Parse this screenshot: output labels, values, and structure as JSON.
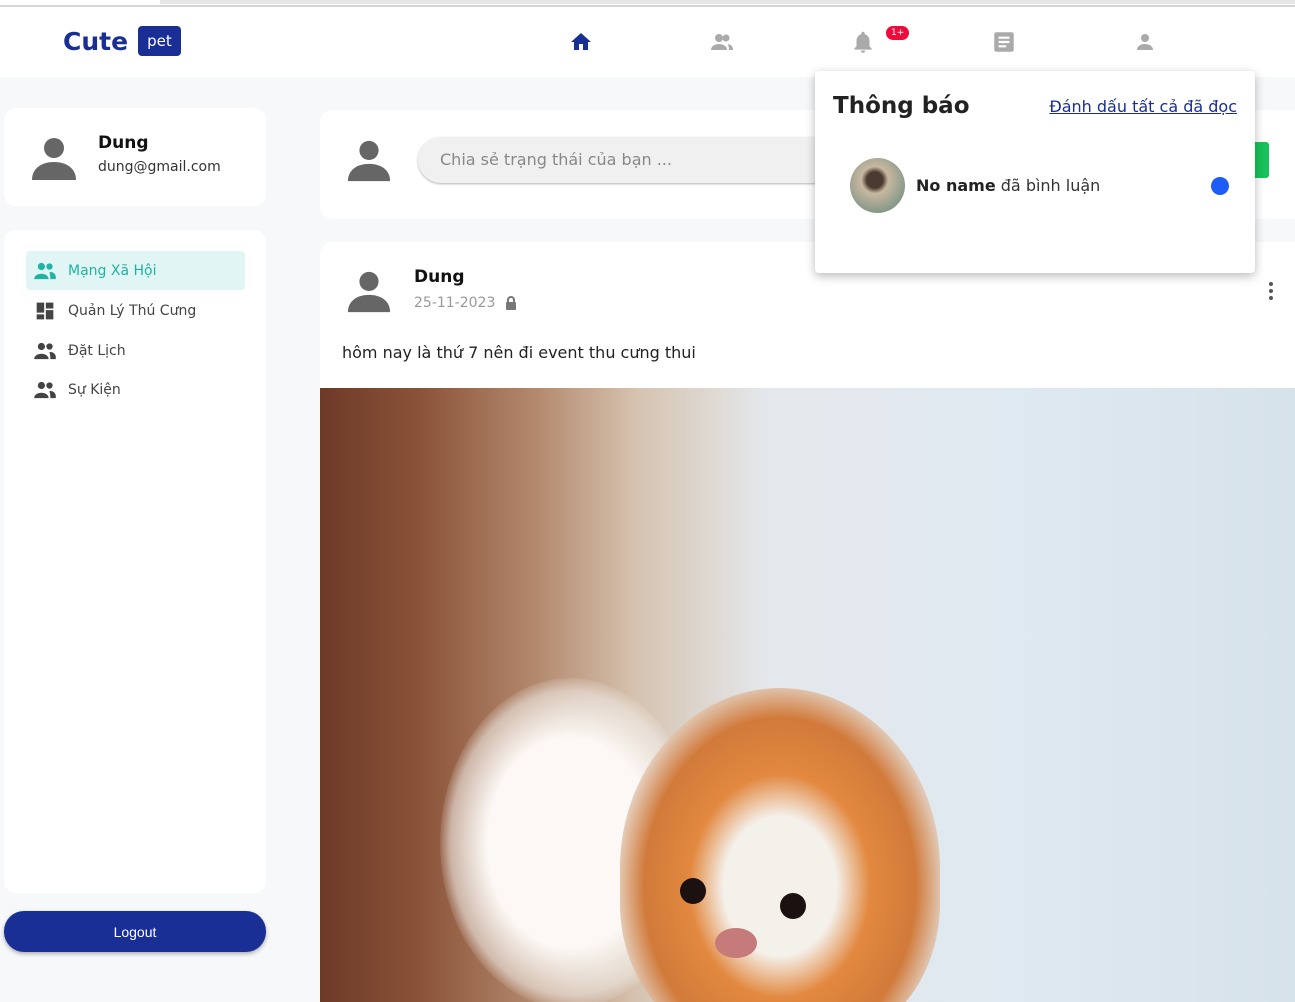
{
  "header": {
    "logo_text": "Cute",
    "logo_badge": "pet",
    "nav": [
      "home-icon",
      "friends-icon",
      "bell-icon",
      "news-icon",
      "user-icon"
    ],
    "notification_badge": "1+",
    "accent": "#1a2f96"
  },
  "profile": {
    "name": "Dung",
    "email": "dung@gmail.com"
  },
  "sidebar": {
    "items": [
      {
        "label": "Mạng Xã Hội",
        "active": true
      },
      {
        "label": "Quản Lý Thú Cưng"
      },
      {
        "label": "Đặt Lịch"
      },
      {
        "label": "Sự Kiện"
      }
    ],
    "logout": "Logout"
  },
  "status": {
    "placeholder": "Chia sẻ trạng thái của bạn ..."
  },
  "post": {
    "author": "Dung",
    "date": "25-11-2023",
    "text": "hôm nay là thứ 7 nên đi event thu cưng thui"
  },
  "notifications": {
    "title": "Thông báo",
    "mark_all": "Đánh dấu tất cả đã đọc",
    "items": [
      {
        "name": "No name",
        "action": "đã bình luận",
        "unread": true
      }
    ]
  }
}
